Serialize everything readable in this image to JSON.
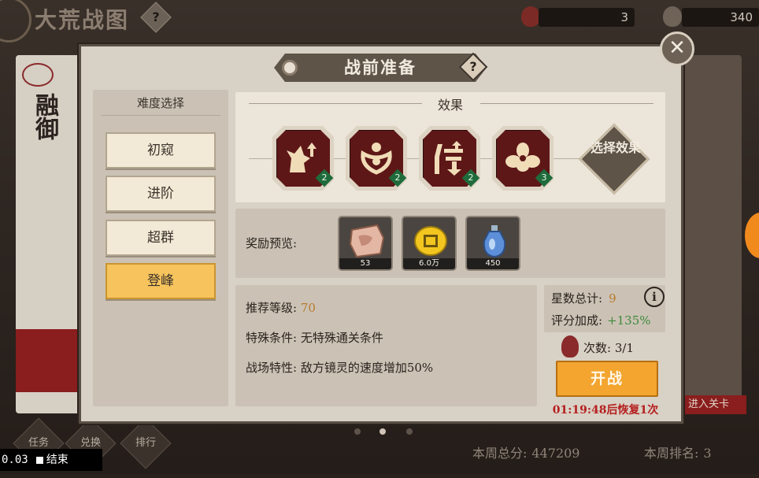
{
  "background": {
    "title": "大荒战图",
    "help_glyph": "?",
    "resource_1": "3",
    "resource_2": "340",
    "card_text": "融御",
    "right_button": "进入关卡",
    "bottom_nav": [
      "任务",
      "兑换",
      "排行"
    ],
    "week_total_label": "本周总分:",
    "week_total_value": "447209",
    "week_rank_label": "本周排名:",
    "week_rank_value": "3",
    "recording_time": "0.03",
    "recording_stop": "结束"
  },
  "dialog": {
    "title": "战前准备",
    "help_glyph": "?",
    "close_glyph": "✕",
    "difficulty": {
      "heading": "难度选择",
      "options": [
        "初窥",
        "进阶",
        "超群",
        "登峰"
      ],
      "selected": "登峰"
    },
    "effects": {
      "heading": "效果",
      "tiles": [
        {
          "icon": "speed-up-icon",
          "level": "2"
        },
        {
          "icon": "shield-figure-icon",
          "level": "2"
        },
        {
          "icon": "damage-down-icon",
          "level": "2"
        },
        {
          "icon": "lotus-icon",
          "level": "3"
        }
      ],
      "select_button": "选择效果"
    },
    "rewards": {
      "label": "奖励预览:",
      "items": [
        {
          "icon": "scroll-fragment-icon",
          "count": "53"
        },
        {
          "icon": "gold-coin-icon",
          "count": "6.0万"
        },
        {
          "icon": "blue-potion-icon",
          "count": "450"
        }
      ]
    },
    "info": {
      "level_label": "推荐等级:",
      "level_value": "70",
      "special_label": "特殊条件:",
      "special_value": "无特殊通关条件",
      "field_label": "战场特性:",
      "field_value": "敌方镜灵的速度增加50%"
    },
    "stars": {
      "total_label": "星数总计:",
      "total_value": "9",
      "bonus_label": "评分加成:",
      "bonus_value": "+135%",
      "info_glyph": "i"
    },
    "attempts": {
      "label": "次数:",
      "value": "3/1"
    },
    "battle_button": "开战",
    "recover_text": "01:19:48后恢复1次"
  },
  "colors": {
    "selected_difficulty": "#f6c35c",
    "battle_button": "#f3a530",
    "level_value": "#b87a2e",
    "bonus_value": "#3f8a3a",
    "recover_text": "#b51f1f"
  }
}
